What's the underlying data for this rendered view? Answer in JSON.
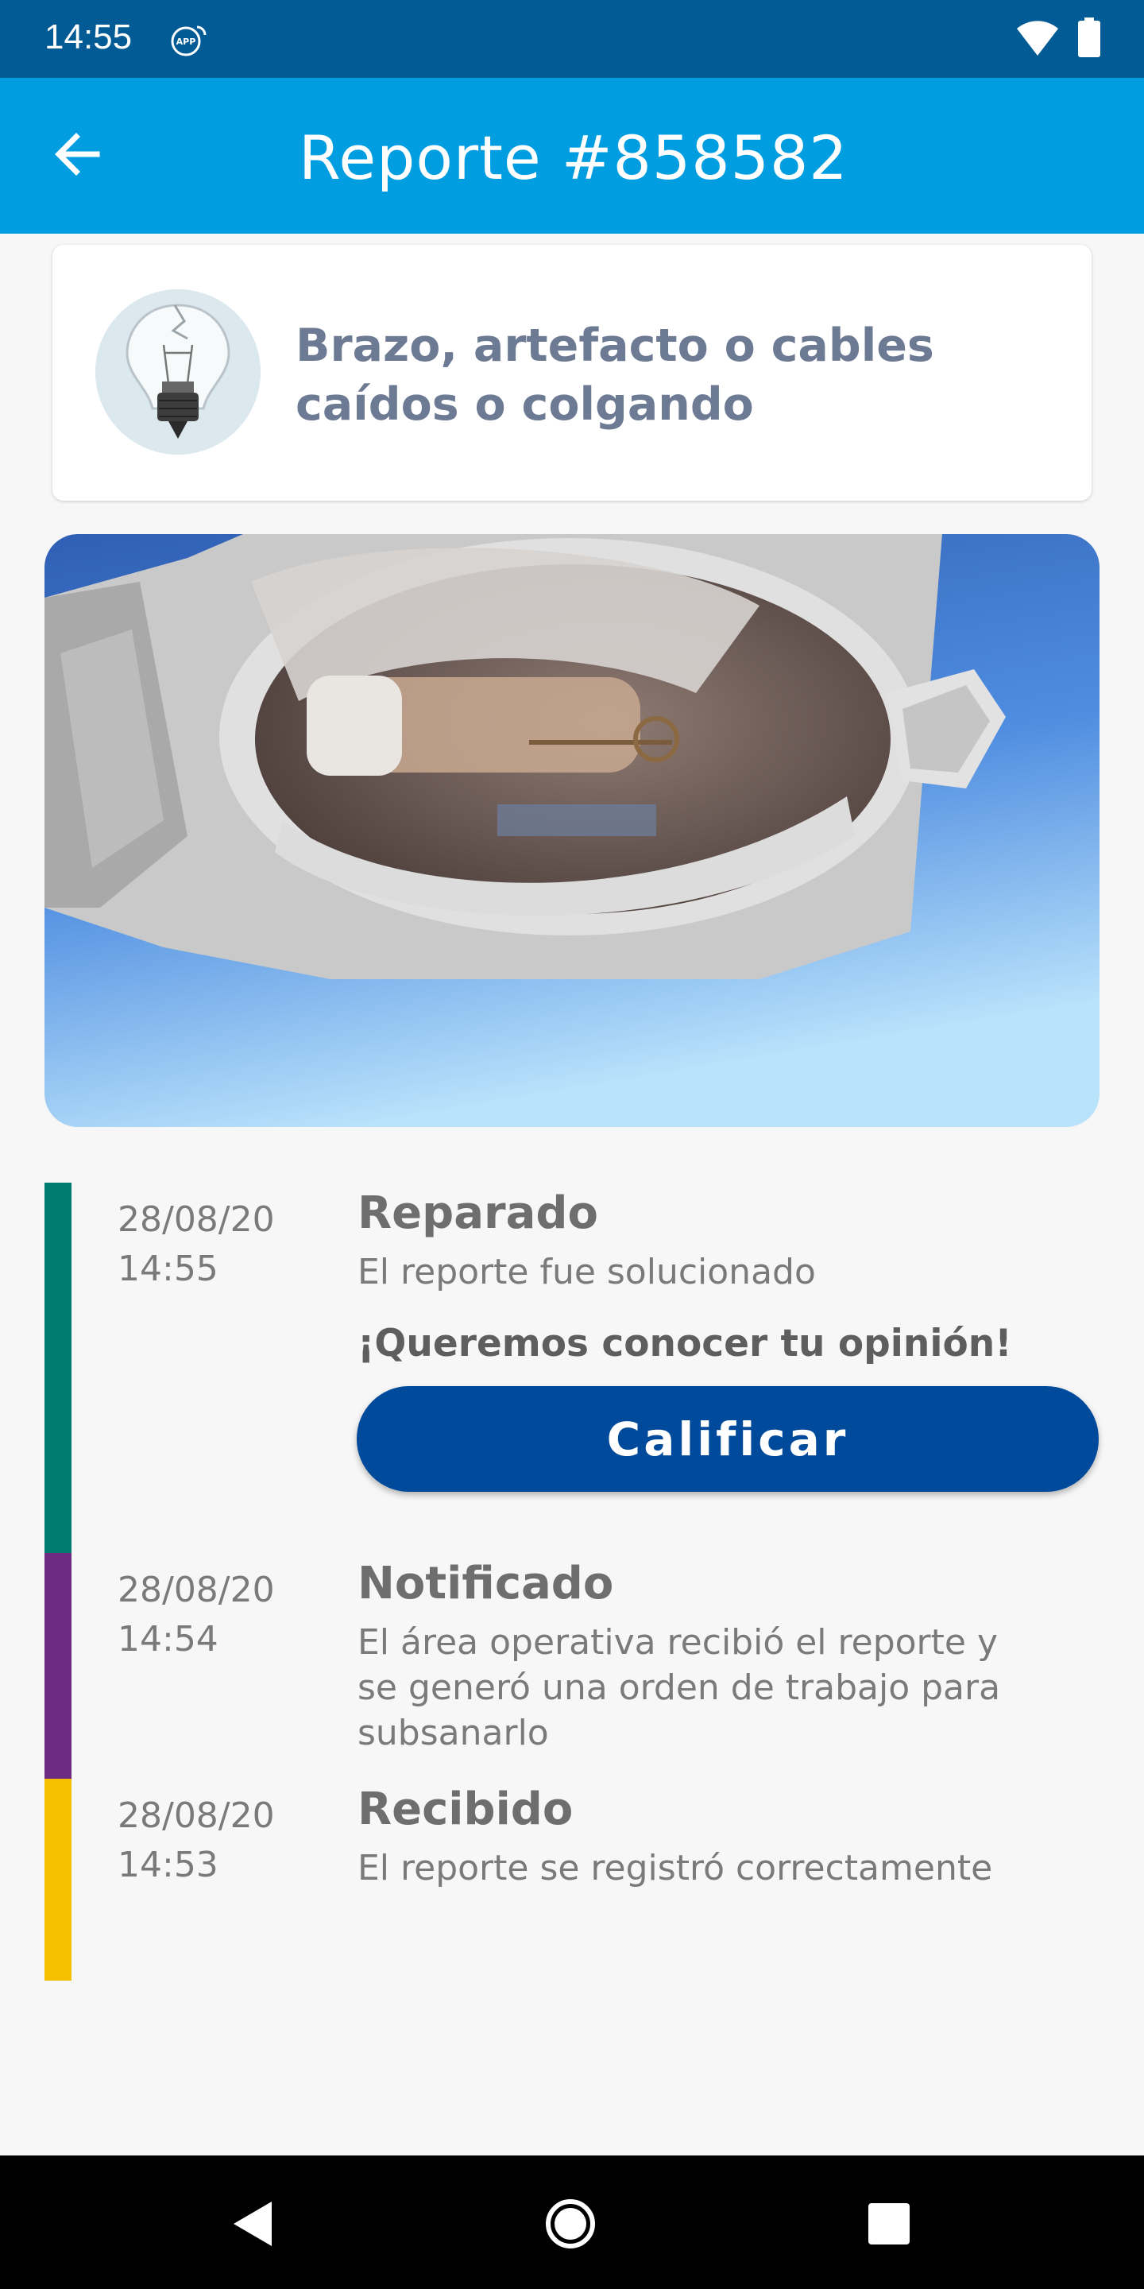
{
  "status_bar": {
    "time": "14:55",
    "app_icon": "app-badge-icon",
    "wifi_icon": "wifi-icon",
    "battery_icon": "battery-icon"
  },
  "app_bar": {
    "back_icon": "arrow-back-icon",
    "title": "Reporte #858582",
    "color": "#009ee0"
  },
  "category": {
    "icon": "broken-bulb-icon",
    "title": "Brazo, artefacto o cables caídos o colgando"
  },
  "photo": {
    "subject": "street-lamp-photo"
  },
  "timeline": [
    {
      "date": "28/08/20",
      "time": "14:55",
      "status": "Reparado",
      "description": "El reporte fue solucionado",
      "color": "#007c6e"
    },
    {
      "date": "28/08/20",
      "time": "14:54",
      "status": "Notificado",
      "description": "El área operativa recibió el reporte y se generó una orden de trabajo para subsanarlo",
      "color": "#6d2b84"
    },
    {
      "date": "28/08/20",
      "time": "14:53",
      "status": "Recibido",
      "description": "El reporte se registró correctamente",
      "color": "#f5c000"
    }
  ],
  "feedback": {
    "prompt": "¡Queremos conocer tu opinión!",
    "button_label": "Calificar",
    "button_color": "#004a9b"
  },
  "nav_bar": {
    "back_icon": "triangle-back-icon",
    "home_icon": "circle-home-icon",
    "recents_icon": "square-recents-icon"
  }
}
